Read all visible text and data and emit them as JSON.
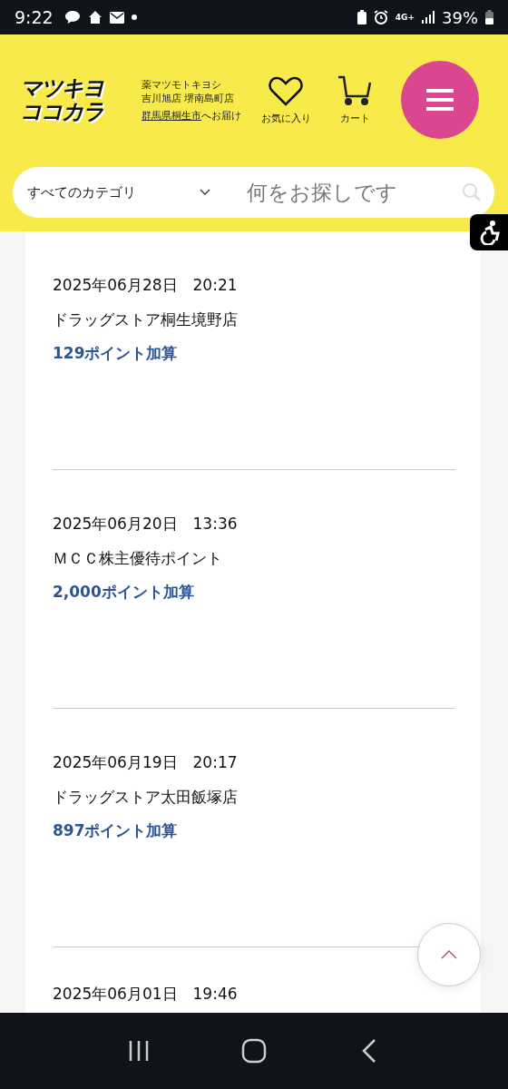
{
  "status_bar": {
    "time": "9:22",
    "battery": "39%",
    "network": "4G+"
  },
  "header": {
    "logo": [
      "マツキヨ",
      "ココカラ"
    ],
    "store_lines": [
      "薬マツモトキヨシ",
      "吉川旭店 堺南島町店"
    ],
    "delivery_link": "群馬県桐生市",
    "delivery_suffix": "へお届け",
    "favorites": "お気に入り",
    "cart": "カート"
  },
  "search": {
    "category": "すべてのカテゴリ",
    "placeholder": "何をお探しです"
  },
  "history": [
    {
      "datetime": "2025年06月28日　20:21",
      "store": "ドラッグストア桐生境野店",
      "points": "129ポイント加算"
    },
    {
      "datetime": "2025年06月20日　13:36",
      "store": "ＭＣＣ株主優待ポイント",
      "points": "2,000ポイント加算"
    },
    {
      "datetime": "2025年06月19日　20:17",
      "store": "ドラッグストア太田飯塚店",
      "points": "897ポイント加算"
    },
    {
      "datetime": "2025年06月01日　19:46"
    }
  ]
}
